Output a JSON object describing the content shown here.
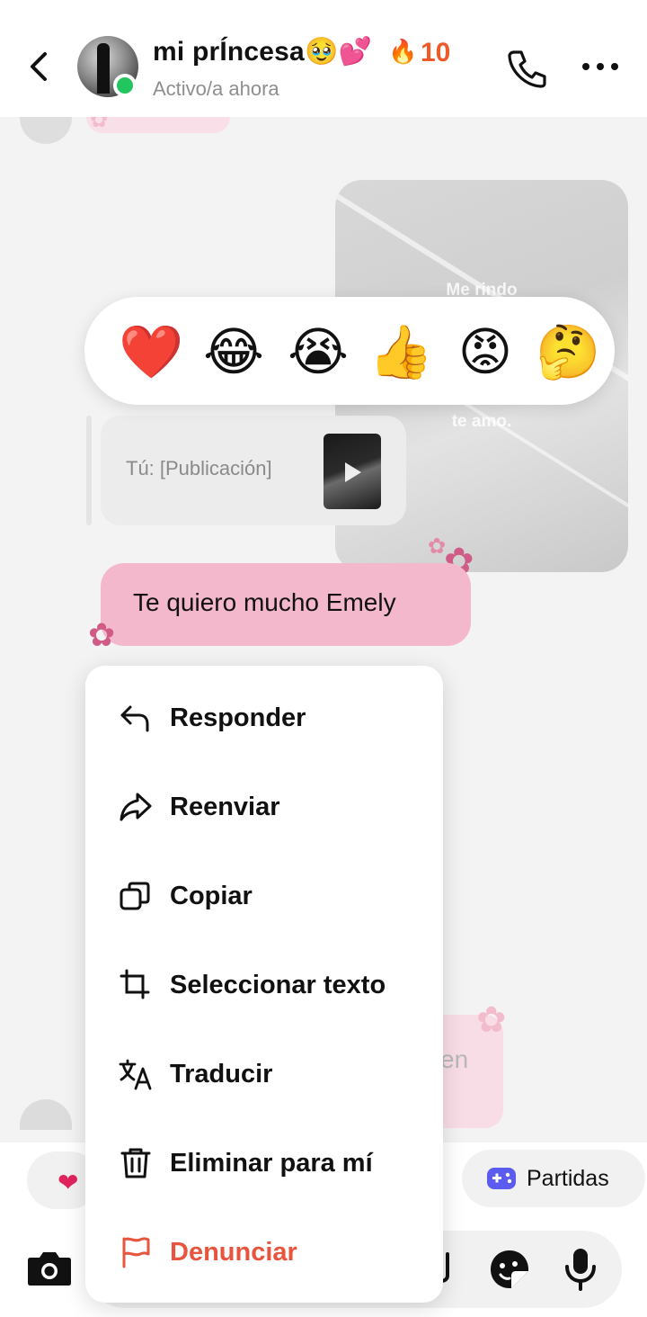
{
  "header": {
    "contact_name": "mi prÍncesa🥹💕",
    "streak_icon": "🔥",
    "streak_count": "10",
    "status": "Activo/a ahora"
  },
  "chat": {
    "post_overlay_lines": [
      "Me rindo",
      "te amo."
    ],
    "reply_quote_label": "Tú: [Publicación]",
    "my_message": "Te quiero mucho Emely",
    "faded_background_text": "en"
  },
  "reactions": [
    "❤️",
    "😂",
    "😭",
    "👍",
    "😡",
    "🤔"
  ],
  "context_menu": {
    "items": [
      {
        "label": "Responder",
        "icon": "reply-icon"
      },
      {
        "label": "Reenviar",
        "icon": "forward-icon"
      },
      {
        "label": "Copiar",
        "icon": "copy-icon"
      },
      {
        "label": "Seleccionar texto",
        "icon": "select-text-icon"
      },
      {
        "label": "Traducir",
        "icon": "translate-icon"
      },
      {
        "label": "Eliminar para mí",
        "icon": "trash-icon"
      },
      {
        "label": "Denunciar",
        "icon": "flag-icon"
      }
    ]
  },
  "quick_bar": {
    "heart": "❤",
    "games_label": "Partidas"
  },
  "colors": {
    "accent_pink": "#f3b8cc",
    "danger": "#e8553e",
    "streak": "#f05a28",
    "online": "#22c55e",
    "games_icon": "#5b5bf0"
  }
}
